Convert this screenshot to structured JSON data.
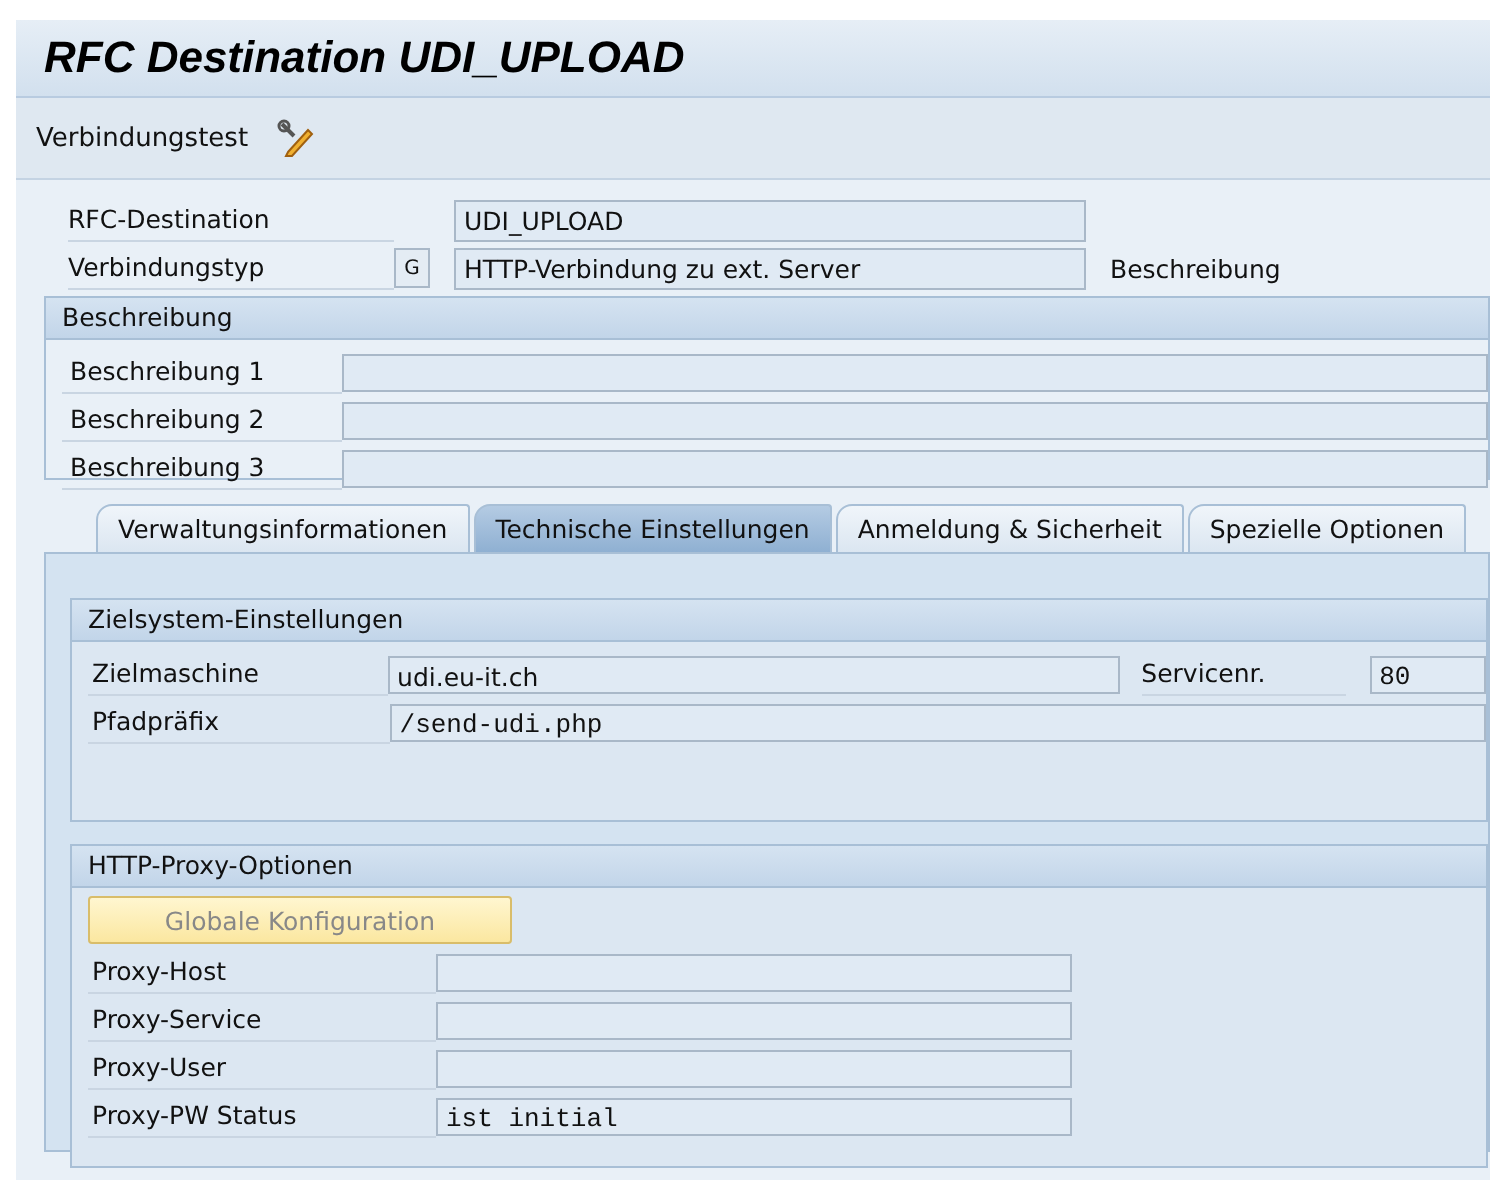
{
  "window": {
    "title": "RFC Destination UDI_UPLOAD"
  },
  "toolbar": {
    "items": [
      {
        "label": "Verbindungstest"
      }
    ]
  },
  "header": {
    "destination": {
      "label": "RFC-Destination",
      "value": "UDI_UPLOAD"
    },
    "type": {
      "label": "Verbindungstyp",
      "code": "G",
      "value": "HTTP-Verbindung zu ext. Server",
      "note": "Beschreibung"
    }
  },
  "description": {
    "title": "Beschreibung",
    "fields": [
      {
        "label": "Beschreibung 1"
      },
      {
        "label": "Beschreibung 2"
      },
      {
        "label": "Beschreibung 3"
      }
    ]
  },
  "tabs": [
    {
      "label": "Verwaltungsinformationen",
      "selected": false
    },
    {
      "label": "Technische Einstellungen",
      "selected": true
    },
    {
      "label": "Anmeldung & Sicherheit",
      "selected": false
    },
    {
      "label": "Spezielle Optionen",
      "selected": false
    }
  ],
  "target": {
    "title": "Zielsystem-Einstellungen",
    "host": {
      "label": "Zielmaschine",
      "value": "udi.eu-it.ch"
    },
    "service": {
      "label": "Servicenr.",
      "value": "80"
    },
    "path": {
      "label": "Pfadpräfix",
      "value": "/send-udi.php"
    }
  },
  "proxy": {
    "title": "HTTP-Proxy-Optionen",
    "button": {
      "label": "Globale Konfiguration",
      "disabled": true
    },
    "fields": [
      {
        "label": "Proxy-Host"
      },
      {
        "label": "Proxy-Service"
      },
      {
        "label": "Proxy-User"
      },
      {
        "label": "Proxy-PW Status",
        "value": "ist initial"
      }
    ]
  }
}
